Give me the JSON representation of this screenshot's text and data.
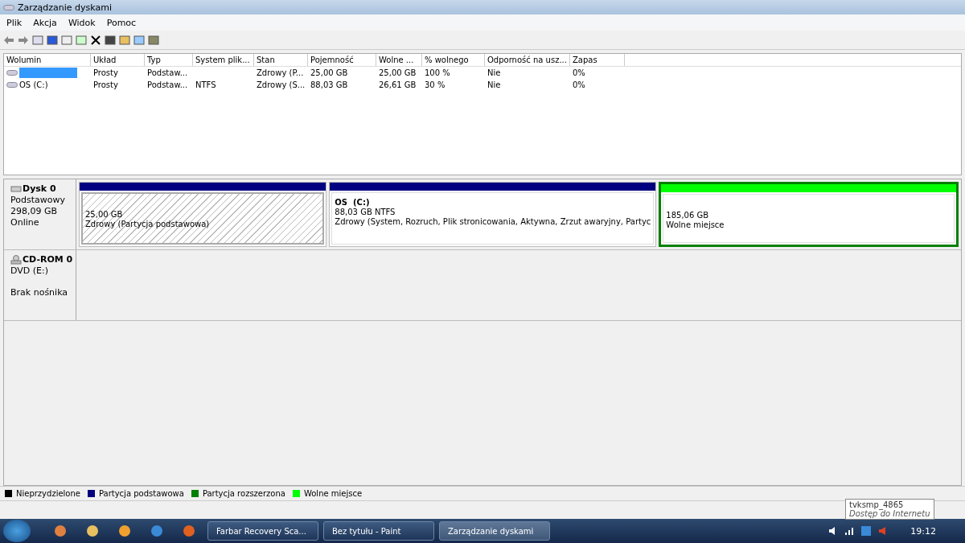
{
  "window": {
    "title": "Zarządzanie dyskami"
  },
  "menu": [
    "Plik",
    "Akcja",
    "Widok",
    "Pomoc"
  ],
  "table": {
    "columns": [
      "Wolumin",
      "Układ",
      "Typ",
      "System plik...",
      "Stan",
      "Pojemność",
      "Wolne ...",
      "% wolnego",
      "Odporność na usz...",
      "Zapas"
    ],
    "rows": [
      {
        "kind": "redacted",
        "cells": [
          "",
          "Prosty",
          "Podstaw...",
          "",
          "Zdrowy (P...",
          "25,00 GB",
          "25,00 GB",
          "100 %",
          "Nie",
          "0%"
        ]
      },
      {
        "kind": "named",
        "cells": [
          "OS (C:)",
          "Prosty",
          "Podstaw...",
          "NTFS",
          "Zdrowy (S...",
          "88,03 GB",
          "26,61 GB",
          "30 %",
          "Nie",
          "0%"
        ]
      }
    ]
  },
  "disks": [
    {
      "name": "Dysk 0",
      "lines": [
        "Podstawowy",
        "298,09 GB",
        "Online"
      ],
      "kind": "hdd",
      "partitions": [
        {
          "color": "#000080",
          "selected": true,
          "lines": [
            "25,00 GB",
            "Zdrowy (Partycja podstawowa)"
          ]
        },
        {
          "color": "#000080",
          "selected": false,
          "title": "OS  (C:)",
          "lines": [
            "88,03 GB NTFS",
            "Zdrowy (System, Rozruch, Plik stronicowania, Aktywna, Zrzut awaryjny, Partyc"
          ]
        },
        {
          "color": "#00ff00",
          "selected": false,
          "lines": [
            "185,06 GB",
            "Wolne miejsce"
          ]
        }
      ]
    },
    {
      "name": "CD-ROM 0",
      "lines": [
        "DVD (E:)",
        "Brak nośnika"
      ],
      "kind": "cdrom"
    }
  ],
  "legend": [
    {
      "label": "Nieprzydzielone",
      "color": "#000000"
    },
    {
      "label": "Partycja podstawowa",
      "color": "#000080"
    },
    {
      "label": "Partycja rozszerzona",
      "color": "#008000"
    },
    {
      "label": "Wolne miejsce",
      "color": "#00ff00"
    }
  ],
  "tooltip": {
    "title": "tvksmp_4865",
    "subtitle": "Dostęp do Internetu"
  },
  "taskbar": {
    "tasks": [
      {
        "label": "Farbar Recovery Sca...",
        "selected": false
      },
      {
        "label": "Bez tytułu - Paint",
        "selected": false
      },
      {
        "label": "Zarządzanie dyskami",
        "selected": true
      }
    ],
    "clock": "19:12"
  }
}
